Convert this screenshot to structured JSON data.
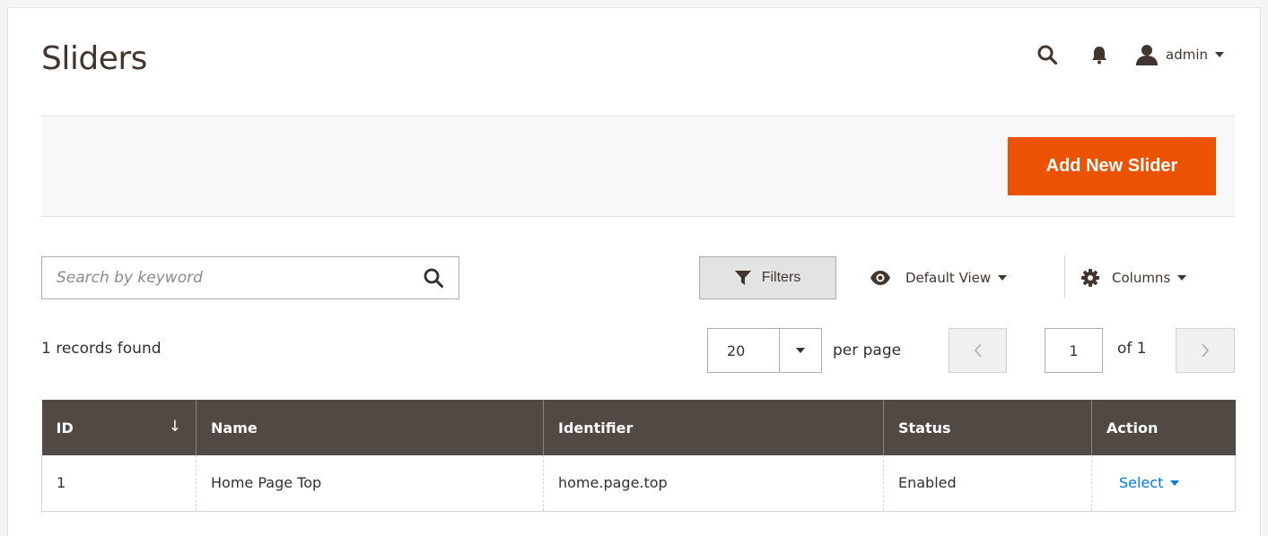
{
  "header": {
    "title": "Sliders",
    "user_name": "admin",
    "search_icon": "search-icon",
    "bell_icon": "bell-icon",
    "user_icon": "user-icon"
  },
  "actions": {
    "add_new_label": "Add New Slider"
  },
  "toolbar": {
    "search_placeholder": "Search by keyword",
    "search_value": "",
    "filters_label": "Filters",
    "view_label": "Default View",
    "columns_label": "Columns"
  },
  "pagination": {
    "records_found": "1 records found",
    "per_page_value": "20",
    "per_page_label": "per page",
    "current_page": "1",
    "total_pages_label": "of 1"
  },
  "table": {
    "columns": [
      "ID",
      "Name",
      "Identifier",
      "Status",
      "Action"
    ],
    "sort_indicator": "↓",
    "rows": [
      {
        "id": "1",
        "name": "Home Page Top",
        "identifier": "home.page.top",
        "status": "Enabled",
        "action": "Select"
      }
    ]
  },
  "colors": {
    "accent": "#eb5202",
    "header_bg": "#514943",
    "link": "#007bdb"
  }
}
